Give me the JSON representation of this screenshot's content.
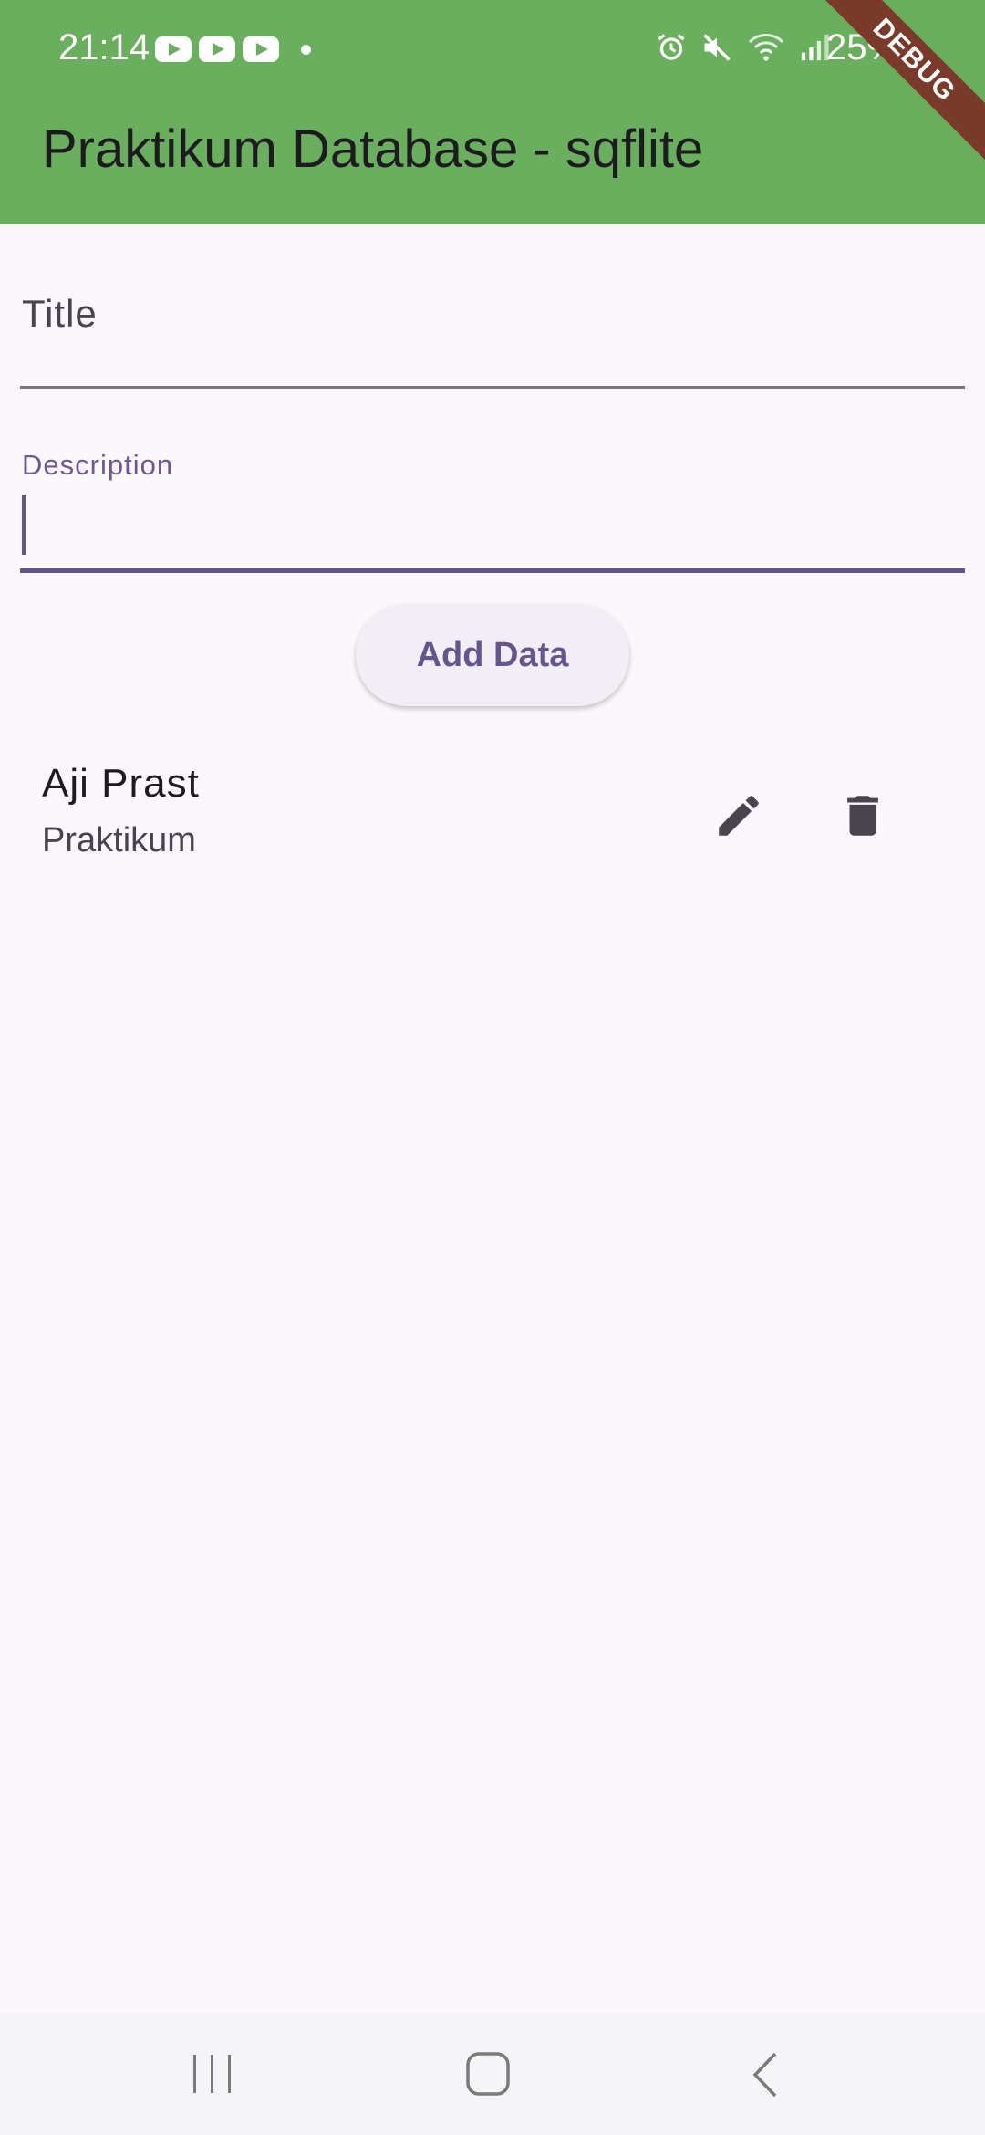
{
  "status_bar": {
    "time": "21:14",
    "battery": "25%",
    "notification_icons": [
      "youtube-icon",
      "youtube-icon",
      "youtube-icon",
      "dot-icon"
    ],
    "system_icons": [
      "alarm-icon",
      "mute-icon",
      "wifi-icon",
      "signal-icon"
    ]
  },
  "debug_banner": "DEBUG",
  "app_bar": {
    "title": "Praktikum Database - sqflite",
    "color": "#6aaf5e"
  },
  "form": {
    "title_field": {
      "label": "Title",
      "value": ""
    },
    "description_field": {
      "label": "Description",
      "value": ""
    },
    "add_button_label": "Add Data"
  },
  "items": [
    {
      "title": "Aji Prast",
      "description": "Praktikum",
      "actions": [
        "edit-icon",
        "delete-icon"
      ]
    }
  ],
  "colors": {
    "primary": "#65558f",
    "background": "#fcf7fc",
    "icon": "#49454f"
  },
  "nav_bar": [
    "recents-button",
    "home-button",
    "back-button"
  ]
}
